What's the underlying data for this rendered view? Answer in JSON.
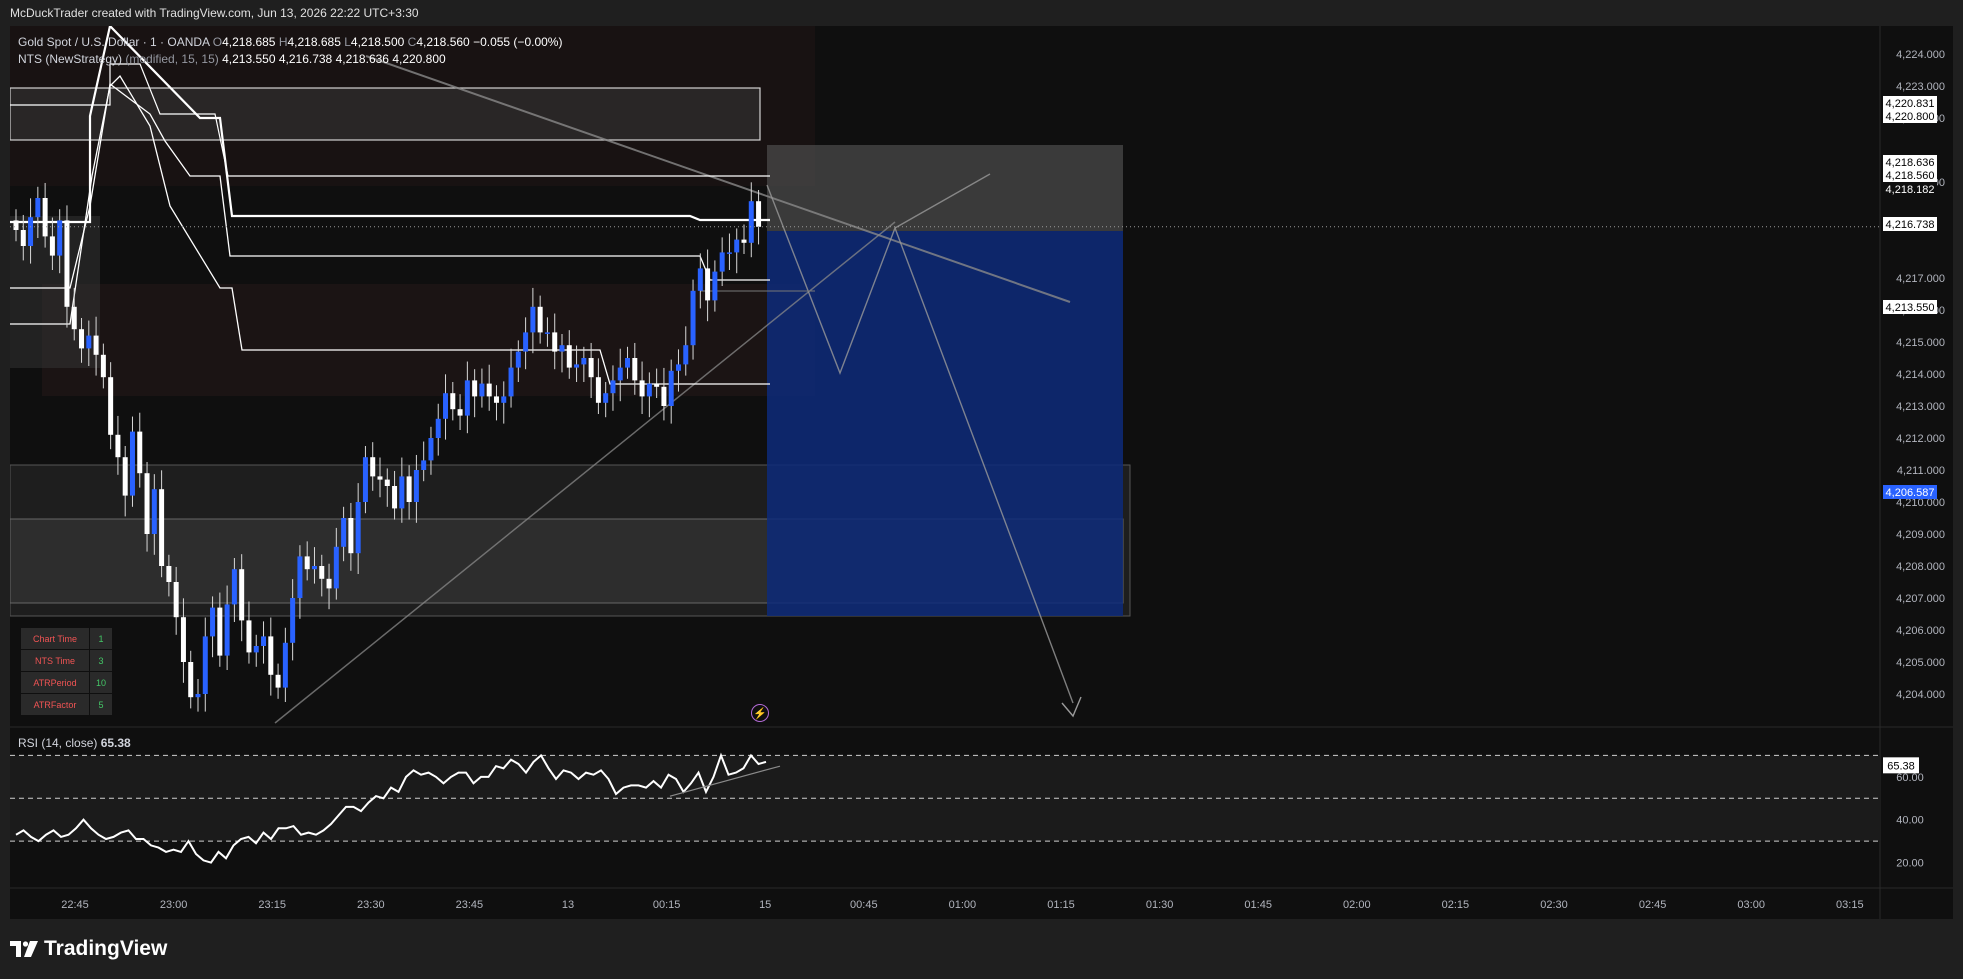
{
  "caption": "McDuckTrader created with TradingView.com, Jun 13, 2026 22:22 UTC+3:30",
  "legend": {
    "symbol": "Gold Spot / U.S. Dollar · 1 · OANDA",
    "o_label": "O",
    "o": "4,218.685",
    "h_label": "H",
    "h": "4,218.685",
    "l_label": "L",
    "l": "4,218.500",
    "c_label": "C",
    "c": "4,218.560",
    "change": "−0.055 (−0.00%)",
    "indicator": "NTS (NewStrategy)",
    "indicator_params": "(modified, 15, 15)",
    "ind_v1": "4,213.550",
    "ind_v2": "4,216.738",
    "ind_v3": "4,218.636",
    "ind_v4": "4,220.800"
  },
  "rsi_legend": {
    "name": "RSI (14, close)",
    "value": "65.38"
  },
  "info_table": [
    {
      "key": "Chart Time",
      "value": "1"
    },
    {
      "key": "NTS Time",
      "value": "3"
    },
    {
      "key": "ATRPeriod",
      "value": "10"
    },
    {
      "key": "ATRFactor",
      "value": "5"
    }
  ],
  "brand": "TradingView",
  "colors": {
    "background": "#0f0f0f",
    "bull": "#2962ff",
    "bear": "#ffffff",
    "target_zone": "#0d2a7a",
    "stop_zone": "#3a3a3a",
    "price_tag": "#ffffff",
    "blue_tag": "#2962ff",
    "table_key": "#f05454",
    "table_value": "#44c767"
  },
  "chart_data": {
    "type": "candlestick",
    "symbol": "XAUUSD",
    "timeframe": "1",
    "x_ticks": [
      "22:45",
      "23:00",
      "23:15",
      "23:30",
      "23:45",
      "13",
      "00:15",
      "15",
      "00:45",
      "01:00",
      "01:15",
      "01:30",
      "01:45",
      "02:00",
      "02:15",
      "02:30",
      "02:45",
      "03:00",
      "03:15"
    ],
    "price_ticks": [
      "4,224.000",
      "4,223.000",
      "4,222.000",
      "4,220.000",
      "4,217.000",
      "4,216.000",
      "4,215.000",
      "4,214.000",
      "4,213.000",
      "4,212.000",
      "4,211.000",
      "4,210.000",
      "4,209.000",
      "4,208.000",
      "4,207.000",
      "4,206.000",
      "4,205.000",
      "4,204.000"
    ],
    "price_ylim": [
      4203.0,
      4224.5
    ],
    "price_labels": [
      {
        "text": "4,220.831",
        "style": "white"
      },
      {
        "text": "4,220.800",
        "style": "white"
      },
      {
        "text": "4,218.636",
        "style": "white"
      },
      {
        "text": "4,218.560",
        "style": "white"
      },
      {
        "text": "4,218.182",
        "style": "dark"
      },
      {
        "text": "4,216.738",
        "style": "white"
      },
      {
        "text": "4,213.550",
        "style": "white"
      },
      {
        "text": "4,206.587",
        "style": "blue"
      }
    ],
    "candles_close": [
      4218.5,
      4218.0,
      4218.9,
      4219.5,
      4218.3,
      4217.7,
      4218.8,
      4216.1,
      4215.4,
      4214.8,
      4215.2,
      4214.6,
      4213.9,
      4212.1,
      4211.4,
      4210.2,
      4212.2,
      4210.9,
      4209.0,
      4210.4,
      4208.0,
      4207.5,
      4206.4,
      4205.0,
      4203.9,
      4204.0,
      4205.8,
      4206.7,
      4205.2,
      4206.8,
      4207.9,
      4206.3,
      4205.3,
      4205.5,
      4205.8,
      4204.6,
      4204.2,
      4205.6,
      4207.0,
      4208.3,
      4207.9,
      4208.0,
      4207.6,
      4207.3,
      4208.6,
      4209.5,
      4208.4,
      4210.0,
      4211.4,
      4210.8,
      4210.7,
      4210.5,
      4209.8,
      4210.8,
      4210.0,
      4211.0,
      4211.3,
      4212.0,
      4212.6,
      4213.4,
      4212.9,
      4212.7,
      4213.8,
      4213.3,
      4213.7,
      4213.3,
      4213.1,
      4213.3,
      4214.2,
      4214.7,
      4215.3,
      4216.1,
      4215.3,
      4215.3,
      4214.7,
      4214.9,
      4214.2,
      4214.3,
      4214.5,
      4213.9,
      4213.1,
      4213.4,
      4213.8,
      4214.2,
      4214.5,
      4213.8,
      4213.3,
      4213.7,
      4213.6,
      4213.0,
      4214.1,
      4214.3,
      4214.9,
      4216.6,
      4217.3,
      4216.3,
      4217.2,
      4217.8,
      4217.8,
      4218.2,
      4218.1,
      4219.4,
      4218.6
    ],
    "rsi": {
      "ylim": [
        10,
        80
      ],
      "ticks": [
        "60.00",
        "40.00",
        "20.00"
      ],
      "bands": [
        70,
        50,
        30
      ],
      "last_label": "65.38",
      "values": [
        33,
        35,
        32,
        30,
        33,
        35,
        32,
        33,
        36,
        40,
        36,
        33,
        31,
        32,
        34,
        35,
        31,
        31,
        28,
        27,
        25,
        26,
        25,
        30,
        24,
        21,
        20,
        25,
        22,
        28,
        31,
        32,
        29,
        34,
        31,
        36,
        36,
        37,
        33,
        34,
        33,
        35,
        38,
        42,
        46,
        46,
        44,
        48,
        51,
        50,
        55,
        53,
        60,
        63,
        61,
        62,
        60,
        57,
        60,
        62,
        62,
        57,
        60,
        60,
        65,
        64,
        68,
        66,
        62,
        67,
        70,
        64,
        59,
        63,
        62,
        59,
        62,
        61,
        63,
        59,
        52,
        55,
        56,
        56,
        55,
        58,
        55,
        61,
        59,
        53,
        57,
        62,
        53,
        60,
        70,
        61,
        62,
        64,
        70,
        66,
        67
      ]
    }
  }
}
